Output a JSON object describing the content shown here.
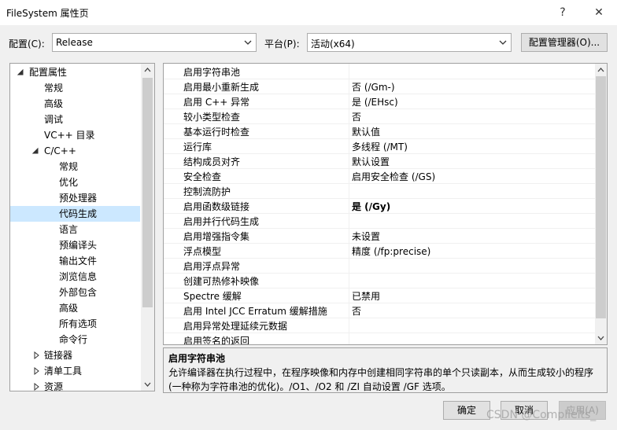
{
  "window": {
    "title": "FileSystem 属性页",
    "help": "?",
    "close": "✕"
  },
  "toolbar": {
    "config_label": "配置(C):",
    "config_value": "Release",
    "platform_label": "平台(P):",
    "platform_value": "活动(x64)",
    "manager_button": "配置管理器(O)..."
  },
  "tree": {
    "items": [
      {
        "label": "配置属性",
        "level": 0,
        "caret": "expanded"
      },
      {
        "label": "常规",
        "level": 1
      },
      {
        "label": "高级",
        "level": 1
      },
      {
        "label": "调试",
        "level": 1
      },
      {
        "label": "VC++ 目录",
        "level": 1
      },
      {
        "label": "C/C++",
        "level": 1,
        "caret": "expanded"
      },
      {
        "label": "常规",
        "level": 2
      },
      {
        "label": "优化",
        "level": 2
      },
      {
        "label": "预处理器",
        "level": 2
      },
      {
        "label": "代码生成",
        "level": 2,
        "selected": true
      },
      {
        "label": "语言",
        "level": 2
      },
      {
        "label": "预编译头",
        "level": 2
      },
      {
        "label": "输出文件",
        "level": 2
      },
      {
        "label": "浏览信息",
        "level": 2
      },
      {
        "label": "外部包含",
        "level": 2
      },
      {
        "label": "高级",
        "level": 2
      },
      {
        "label": "所有选项",
        "level": 2
      },
      {
        "label": "命令行",
        "level": 2
      },
      {
        "label": "链接器",
        "level": 1,
        "caret": "collapsed"
      },
      {
        "label": "清单工具",
        "level": 1,
        "caret": "collapsed"
      },
      {
        "label": "资源",
        "level": 1,
        "caret": "collapsed"
      }
    ]
  },
  "properties": [
    {
      "name": "启用字符串池",
      "value": ""
    },
    {
      "name": "启用最小重新生成",
      "value": "否 (/Gm-)"
    },
    {
      "name": "启用 C++ 异常",
      "value": "是 (/EHsc)"
    },
    {
      "name": "较小类型检查",
      "value": "否"
    },
    {
      "name": "基本运行时检查",
      "value": "默认值"
    },
    {
      "name": "运行库",
      "value": "多线程 (/MT)"
    },
    {
      "name": "结构成员对齐",
      "value": "默认设置"
    },
    {
      "name": "安全检查",
      "value": "启用安全检查 (/GS)"
    },
    {
      "name": "控制流防护",
      "value": ""
    },
    {
      "name": "启用函数级链接",
      "value": "是 (/Gy)",
      "bold": true
    },
    {
      "name": "启用并行代码生成",
      "value": ""
    },
    {
      "name": "启用增强指令集",
      "value": "未设置"
    },
    {
      "name": "浮点模型",
      "value": "精度 (/fp:precise)"
    },
    {
      "name": "启用浮点异常",
      "value": ""
    },
    {
      "name": "创建可热修补映像",
      "value": ""
    },
    {
      "name": "Spectre 缓解",
      "value": "已禁用"
    },
    {
      "name": "启用 Intel JCC Erratum 缓解措施",
      "value": "否"
    },
    {
      "name": "启用异常处理延续元数据",
      "value": ""
    },
    {
      "name": "启用签名的返回",
      "value": ""
    }
  ],
  "description": {
    "title": "启用字符串池",
    "text": "允许编译器在执行过程中，在程序映像和内存中创建相同字符串的单个只读副本，从而生成较小的程序(一种称为字符串池的优化)。/O1、/O2 和 /ZI 自动设置 /GF 选项。"
  },
  "buttons": {
    "ok": "确定",
    "cancel": "取消",
    "apply": "应用(A)"
  },
  "watermark": "CSDN @Complieits_",
  "colors": {
    "selection": "#cce8ff",
    "border": "#a0a0a0",
    "background": "#f0f0f0"
  }
}
